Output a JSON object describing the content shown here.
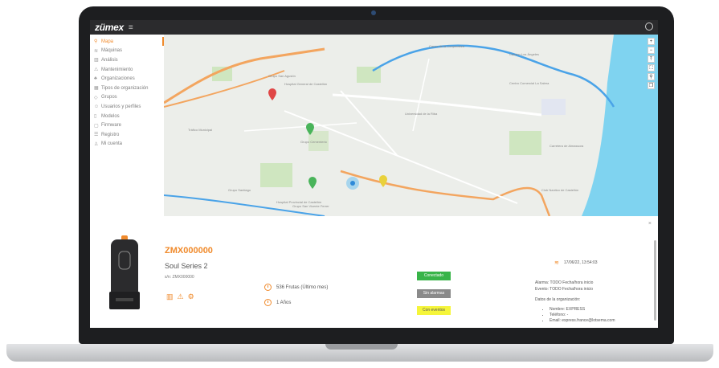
{
  "app": {
    "logo": "zümex",
    "menu_icon": "hamburger-icon",
    "user_icon": "user-circle-icon"
  },
  "sidebar": {
    "items": [
      {
        "label": "Mapa",
        "icon": "map-pin-icon",
        "active": true
      },
      {
        "label": "Máquinas",
        "icon": "wifi-icon",
        "active": false
      },
      {
        "label": "Análisis",
        "icon": "bar-chart-icon",
        "active": false
      },
      {
        "label": "Mantenimiento",
        "icon": "warning-icon",
        "active": false
      },
      {
        "label": "Organizaciones",
        "icon": "org-tree-icon",
        "active": false
      },
      {
        "label": "Tipos de organización",
        "icon": "grid-icon",
        "active": false
      },
      {
        "label": "Grupos",
        "icon": "tag-icon",
        "active": false
      },
      {
        "label": "Usuarios y perfiles",
        "icon": "users-icon",
        "active": false
      },
      {
        "label": "Modelos",
        "icon": "device-icon",
        "active": false
      },
      {
        "label": "Firmware",
        "icon": "file-icon",
        "active": false
      },
      {
        "label": "Registro",
        "icon": "list-icon",
        "active": false
      },
      {
        "label": "Mi cuenta",
        "icon": "user-icon",
        "active": false
      }
    ]
  },
  "map": {
    "controls": [
      "+",
      "−",
      "⤒",
      "⛶",
      "⚲",
      "❐"
    ],
    "labels": [
      "Carrer de la Cooperativa",
      "Camino Los Ángeles",
      "Grupo San Agustín",
      "Hospital General de Castellón",
      "Centro Comercial La Salera",
      "Grupo Cementerio",
      "Tráfico Municipal",
      "Universidad de la Riba",
      "Grupo Santiago",
      "Hospital Provincial de Castellón",
      "Grupo San Vicente Ferrer",
      "Carretera de Almassora",
      "Club Naútico de Castellón"
    ]
  },
  "panel": {
    "name": "ZMX000000",
    "model": "Soul Series 2",
    "serial": "s/n: ZMX000000",
    "stat_fruits": "536 Frutas (Último mes)",
    "stat_age": "1 Años",
    "status_connected": "Conectado",
    "status_alarms": "Sin alarmas",
    "status_events": "Con eventos",
    "timestamp": "17/06/22, 13:54:03",
    "alarm_line": "Alarma: TODO Fecha/hora inicio",
    "event_line": "Evento: TODO Fecha/hora inicio",
    "org_title": "Datos de la organización:",
    "org_name": "Nombre: EXPRESS",
    "org_phone": "Teléfono: -",
    "org_email": "Email: express.france@lotsema.com",
    "close": "×"
  },
  "colors": {
    "accent": "#f08a2b",
    "connected": "#38b449",
    "alarms": "#8a8a8a",
    "events": "#f5f53a"
  }
}
